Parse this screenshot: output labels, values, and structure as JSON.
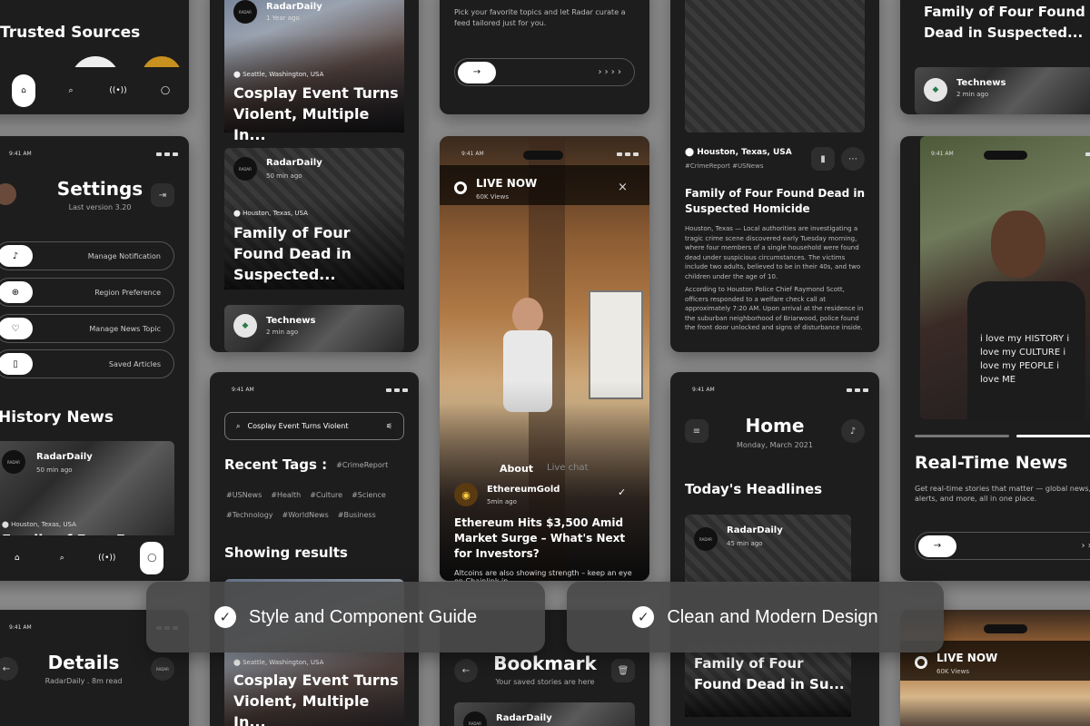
{
  "status_time": "9:41 AM",
  "nav_icons": [
    "home-icon",
    "search-icon",
    "broadcast-icon",
    "profile-icon"
  ],
  "col1": {
    "trusted_title": "Trusted Sources",
    "settings": {
      "title": "Settings",
      "version": "Last version 3.20",
      "items": [
        {
          "icon": "bell-icon",
          "label": "Manage Notification"
        },
        {
          "icon": "globe-icon",
          "label": "Region Preference"
        },
        {
          "icon": "heart-icon",
          "label": "Manage News Topic"
        },
        {
          "icon": "bookmark-icon",
          "label": "Saved Articles"
        }
      ]
    },
    "history_title": "History News",
    "history_source": "RadarDaily",
    "history_time": "50 min ago",
    "history_loc": "Houston, Texas, USA",
    "history_headline": "Family of Four Fo",
    "details": {
      "title": "Details",
      "sub": "RadarDaily . 8m read"
    }
  },
  "col2": {
    "post1": {
      "source": "RadarDaily",
      "time": "1 Year ago",
      "loc": "Seattle, Washington, USA",
      "headline": "Cosplay Event Turns Violent, Multiple In..."
    },
    "post2": {
      "source": "RadarDaily",
      "time": "50 min ago",
      "loc": "Houston, Texas, USA",
      "headline": "Family of Four Found Dead in Suspected..."
    },
    "post3": {
      "source": "Technews",
      "time": "2 min ago"
    },
    "search": {
      "query": "Cosplay Event Turns Violent",
      "recent_title": "Recent Tags :",
      "tags": [
        "#CrimeReport",
        "#USNews",
        "#Health",
        "#Culture",
        "#Science",
        "#Technology",
        "#WorldNews",
        "#Business"
      ],
      "results_title": "Showing results"
    },
    "post4": {
      "loc": "Seattle, Washington, USA",
      "headline": "Cosplay Event Turns Violent, Multiple In..."
    }
  },
  "col3": {
    "onboard_text": "Pick your favorite topics and let Radar curate a feed tailored just for you.",
    "live": {
      "label": "LIVE NOW",
      "views": "60K Views",
      "tab_about": "About",
      "tab_chat": "Live chat",
      "source": "EthereumGold",
      "time": "5min ago",
      "headline": "Ethereum Hits $3,500 Amid Market Surge – What's Next for Investors?",
      "excerpt": "Altcoins are also showing strength – keep an eye on Chainlink in..."
    },
    "bookmark": {
      "title": "Bookmark",
      "sub": "Your saved stories are here",
      "source": "RadarDaily"
    }
  },
  "col4": {
    "article": {
      "loc": "Houston, Texas, USA",
      "tags": "#CrimeReport #USNews",
      "headline": "Family of Four Found Dead in Suspected Homicide",
      "p1": "Houston, Texas — Local authorities are investigating a tragic crime scene discovered early Tuesday morning, where four members of a single household were found dead under suspicious circumstances. The victims include two adults, believed to be in their 40s, and two children under the age of 10.",
      "p2": "According to Houston Police Chief Raymond Scott, officers responded to a welfare check call at approximately 7:20 AM. Upon arrival at the residence in the suburban neighborhood of Briarwood, police found the front door unlocked and signs of disturbance inside."
    },
    "home": {
      "title": "Home",
      "date": "Monday, March 2021",
      "section": "Today's Headlines",
      "source": "RadarDaily",
      "time": "45 min ago",
      "headline": "Family of Four Found Dead in Su..."
    }
  },
  "col5": {
    "top_headline": "Family of Four Found Dead in Suspected...",
    "top_source": "Technews",
    "top_time": "2 min ago",
    "shirt_text": "i love my HISTORY i love my CULTURE i love my PEOPLE i love ME",
    "onb_title": "Real-Time News",
    "onb_text": "Get real-time stories that matter — global news, local alerts, and more, all in one place.",
    "live_label": "LIVE NOW",
    "live_views": "60K Views"
  },
  "banners": [
    {
      "label": "Style and Component Guide"
    },
    {
      "label": "Clean and Modern Design"
    }
  ],
  "avatar_text": "RADAR"
}
